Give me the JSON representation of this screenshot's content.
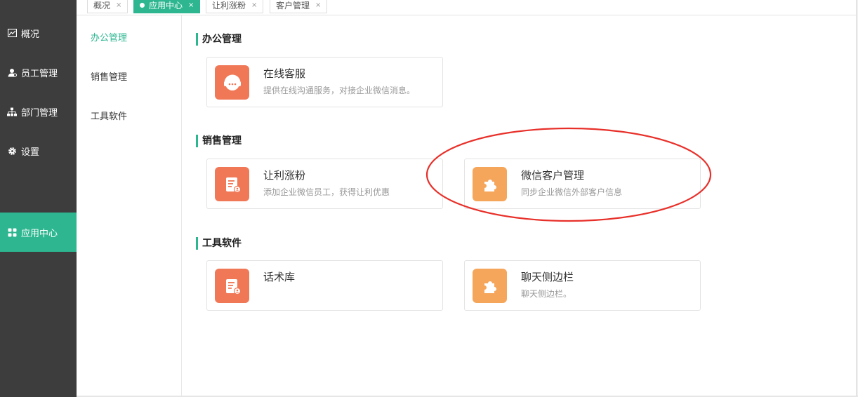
{
  "sidebar": {
    "items": [
      {
        "label": "概况",
        "icon": "chart-icon"
      },
      {
        "label": "员工管理",
        "icon": "user-icon"
      },
      {
        "label": "部门管理",
        "icon": "org-chart-icon"
      },
      {
        "label": "设置",
        "icon": "gear-icon"
      },
      {
        "label": "应用中心",
        "icon": "apps-icon",
        "active": true
      }
    ]
  },
  "tabs": [
    {
      "label": "概况",
      "close": "×"
    },
    {
      "label": "应用中心",
      "close": "×",
      "active": true
    },
    {
      "label": "让利涨粉",
      "close": "×"
    },
    {
      "label": "客户管理",
      "close": "×"
    }
  ],
  "submenu": {
    "items": [
      {
        "label": "办公管理",
        "active": true
      },
      {
        "label": "销售管理"
      },
      {
        "label": "工具软件"
      }
    ]
  },
  "sections": [
    {
      "title": "办公管理",
      "cards": [
        {
          "title": "在线客服",
          "desc": "提供在线沟通服务，对接企业微信消息。",
          "icon": "headset-icon",
          "color": "#f07857"
        }
      ]
    },
    {
      "title": "销售管理",
      "cards": [
        {
          "title": "让利涨粉",
          "desc": "添加企业微信员工，获得让利优惠",
          "icon": "document-user-icon",
          "color": "#f07857"
        },
        {
          "title": "微信客户管理",
          "desc": "同步企业微信外部客户信息",
          "icon": "puzzle-icon",
          "color": "#f5a65b"
        }
      ]
    },
    {
      "title": "工具软件",
      "cards": [
        {
          "title": "话术库",
          "desc": "",
          "icon": "document-user-icon",
          "color": "#f07857"
        },
        {
          "title": "聊天侧边栏",
          "desc": "聊天侧边栏。",
          "icon": "puzzle-icon",
          "color": "#f5a65b"
        }
      ]
    }
  ],
  "colors": {
    "accent": "#2db690",
    "sidebar_bg": "#3d3d3d",
    "annotation": "#e8302a"
  }
}
